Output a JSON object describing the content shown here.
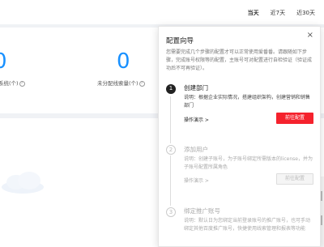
{
  "date_range": {
    "tabs": [
      "当天",
      "近7天",
      "近30天"
    ],
    "active_index": 0
  },
  "stats": [
    {
      "value": "0",
      "label": "系统(个)"
    },
    {
      "value": "0",
      "label": "未分配线索量(个)"
    }
  ],
  "guide": {
    "title": "配置向导",
    "close_symbol": "×",
    "description": "您需要完成几个步骤的配置才可以正常使用爱番番。请跟随如下步骤，完成账号权限等的配置，主账号可对配置进行自检验证（验证成功后不可再验证）。",
    "steps": [
      {
        "number": "1",
        "title": "创建部门",
        "description": "说明：根据企业实际情况，搭建组织架构，创建营销和销售部门",
        "demo_label": "操作演示 >",
        "button_label": "前往配置",
        "state": "active"
      },
      {
        "number": "2",
        "title": "添加用户",
        "description": "说明：创建子账号，为子账号绑定所需版本的license，并为子账号配置所属角色",
        "demo_label": "操作演示 >",
        "button_label": "前往配置",
        "state": "inactive"
      },
      {
        "number": "3",
        "title": "绑定推广账号",
        "description": "说明：默认日为您绑定当前登录账号的推广账号，也可手动绑定其他百度推广账号，快捷使用线索管理和报表等功能",
        "state": "inactive"
      }
    ]
  },
  "colors": {
    "accent_blue": "#1890ff",
    "primary_red": "#f5222d"
  }
}
